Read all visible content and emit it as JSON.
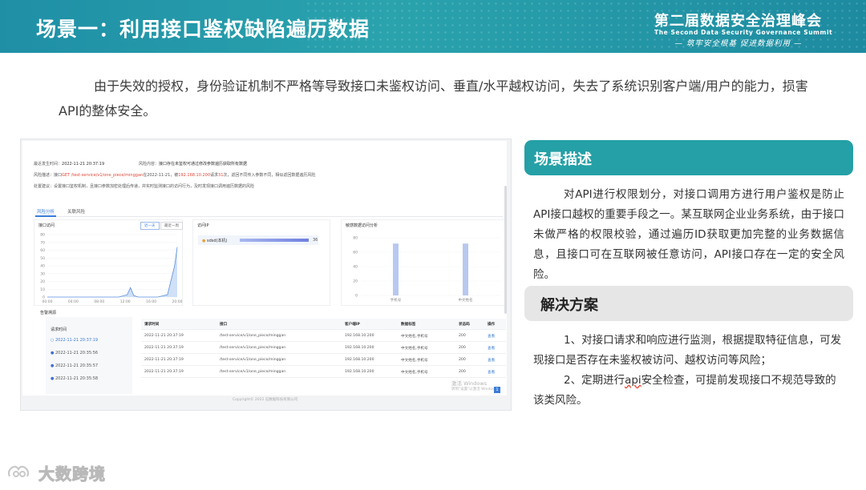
{
  "header": {
    "title": "场景一：利用接口鉴权缺陷遍历数据",
    "logo_main": "第二届数据安全治理峰会",
    "logo_en": "The Second Data Security Governance Summit",
    "logo_slogan": "— 筑牢安全根基  促进数据利用 —"
  },
  "intro": "由于失效的授权，身份验证机制不严格等导致接口未鉴权访问、垂直/水平越权访问，失去了系统识别客户端/用户的能力，损害API的整体安全。",
  "screenshot": {
    "info": {
      "time_label": "最近发生时间：",
      "time_value": "2022-11-21 20:37:19",
      "risk_label": "风险内容：",
      "risk_value": "接口存在未鉴权可通过修改参数遍历获取所有数据",
      "desc_label": "风险描述：",
      "desc_prefix": "接口",
      "desc_api": "GET /test-service/v1/one_piece/minggan",
      "desc_mid1": "在2022-11-21，被",
      "desc_ip": "192.168.10.200",
      "desc_mid2": "请求",
      "desc_count": "31",
      "desc_suffix": "次，返回不同传入参数不同，相似返回数据遍历风险",
      "advice_label": "处置建议：",
      "advice_value": "设置接口鉴权机制，且接口参数加密处理后传递，并实时监测接口的访问行为，及时发现接口调用遍历数据的风险"
    },
    "tabs": [
      "风险分析",
      "关联风险"
    ],
    "panel1": {
      "title": "接口访问",
      "btn_active": "近一天",
      "btn_other": "最近一周",
      "y_ticks": [
        "80",
        "70",
        "60",
        "50",
        "40",
        "30",
        "20",
        "10",
        "0"
      ],
      "x_ticks": [
        "00:00",
        "04:00",
        "08:00",
        "12:00",
        "16:00",
        "20:00"
      ]
    },
    "panel2": {
      "title": "访问IP",
      "user": "sdsd(本机)",
      "count": "36"
    },
    "panel3": {
      "title": "敏感数据访问分析",
      "y_ticks": [
        "80",
        "60",
        "40",
        "20",
        "0"
      ],
      "x_labels": [
        "手机号",
        "中文姓名"
      ]
    },
    "requests": {
      "section_title": "告警溯源",
      "list_title": "请求时间",
      "list_items": [
        "2022-11-21 20:37:19",
        "2022-11-21 20:35:56",
        "2022-11-21 20:35:57",
        "2022-11-21 20:35:58"
      ],
      "columns": [
        "请求时间",
        "接口",
        "客户端IP",
        "数据标签",
        "状态码",
        "操作"
      ],
      "rows": [
        [
          "2022-11-21 20:37:19",
          "/test-service/v1/one_piece/minggan",
          "192.168.10.200",
          "中文姓名,手机号",
          "200",
          "查看"
        ],
        [
          "2022-11-21 20:37:19",
          "/test-service/v1/one_piece/minggan",
          "192.168.10.200",
          "中文姓名,手机号",
          "200",
          "查看"
        ],
        [
          "2022-11-21 20:37:19",
          "/test-service/v1/one_piece/minggan",
          "192.168.10.200",
          "中文姓名,手机号",
          "200",
          "查看"
        ],
        [
          "2022-11-21 20:37:19",
          "/test-service/v1/one_piece/minggan",
          "192.168.10.200",
          "中文姓名,手机号",
          "200",
          "查看"
        ]
      ],
      "pager": "1"
    },
    "watermark_line1": "激活 Windows",
    "watermark_line2": "转到\"设置\"以激活 Windows。",
    "copyright": "Copyright© 2022 石数据科技有限公司"
  },
  "section1": {
    "title": "场景描述",
    "body": "对API进行权限划分，对接口调用方进行用户鉴权是防止API接口越权的重要手段之一。某互联网企业业务系统，由于接口未做严格的权限校验，通过遍历ID获取更加完整的业务数据信息，且接口可在互联网被任意访问，API接口存在一定的安全风险。"
  },
  "section2": {
    "title": "解决方案",
    "item1": "1、对接口请求和响应进行监测，根据提取特征信息，可发现接口是否存在未鉴权被访问、越权访问等风险；",
    "item2_prefix": "2、定期进行",
    "item2_squiggle": "api",
    "item2_suffix": "安全检查，可提前发现接口不规范导致的该类风险。"
  },
  "footer": {
    "logo": "大数跨境"
  },
  "colors": {
    "banner": "#2aa3ad",
    "section1_bar": "#24a0a6",
    "section2_bar": "#e6e6e6",
    "accent_blue": "#3b7dd8",
    "alert_red": "#e04a3a"
  },
  "chart_data": [
    {
      "type": "area",
      "title": "接口访问",
      "x": [
        "00:00",
        "04:00",
        "08:00",
        "12:00",
        "16:00",
        "20:00"
      ],
      "ylim": [
        0,
        80
      ],
      "series": [
        {
          "points": [
            [
              0,
              0
            ],
            [
              4,
              0
            ],
            [
              8,
              0
            ],
            [
              11,
              0
            ],
            [
              12.3,
              3
            ],
            [
              12.8,
              12
            ],
            [
              13.3,
              2
            ],
            [
              14,
              0
            ],
            [
              17,
              0
            ],
            [
              18.5,
              3
            ],
            [
              19.6,
              40
            ],
            [
              20,
              64
            ]
          ]
        }
      ]
    },
    {
      "type": "bar",
      "title": "敏感数据访问分析",
      "categories": [
        "手机号",
        "中文姓名"
      ],
      "values": [
        72,
        72
      ],
      "ylim": [
        0,
        80
      ]
    }
  ]
}
